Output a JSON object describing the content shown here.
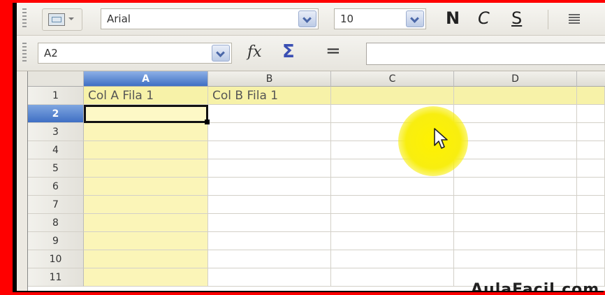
{
  "toolbar": {
    "font_name": "Arial",
    "font_size": "10",
    "bold_label": "N",
    "italic_label": "C",
    "underline_label": "S"
  },
  "formula_bar": {
    "cell_reference": "A2",
    "function_icon": "fx-icon",
    "sum_icon": "sigma-icon",
    "equals_label": "=",
    "formula_value": ""
  },
  "sheet": {
    "columns": [
      "A",
      "B",
      "C",
      "D"
    ],
    "rows": [
      "1",
      "2",
      "3",
      "4",
      "5",
      "6",
      "7",
      "8",
      "9",
      "10",
      "11"
    ],
    "selected_column": "A",
    "selected_row": "2",
    "cells": {
      "A1": "Col A Fila 1",
      "B1": "Col B Fila 1"
    }
  },
  "watermark": "AulaFacil.com",
  "colors": {
    "highlight": "#fbf5b8",
    "selection": "#3f6fc4",
    "frame": "#ff0000"
  }
}
